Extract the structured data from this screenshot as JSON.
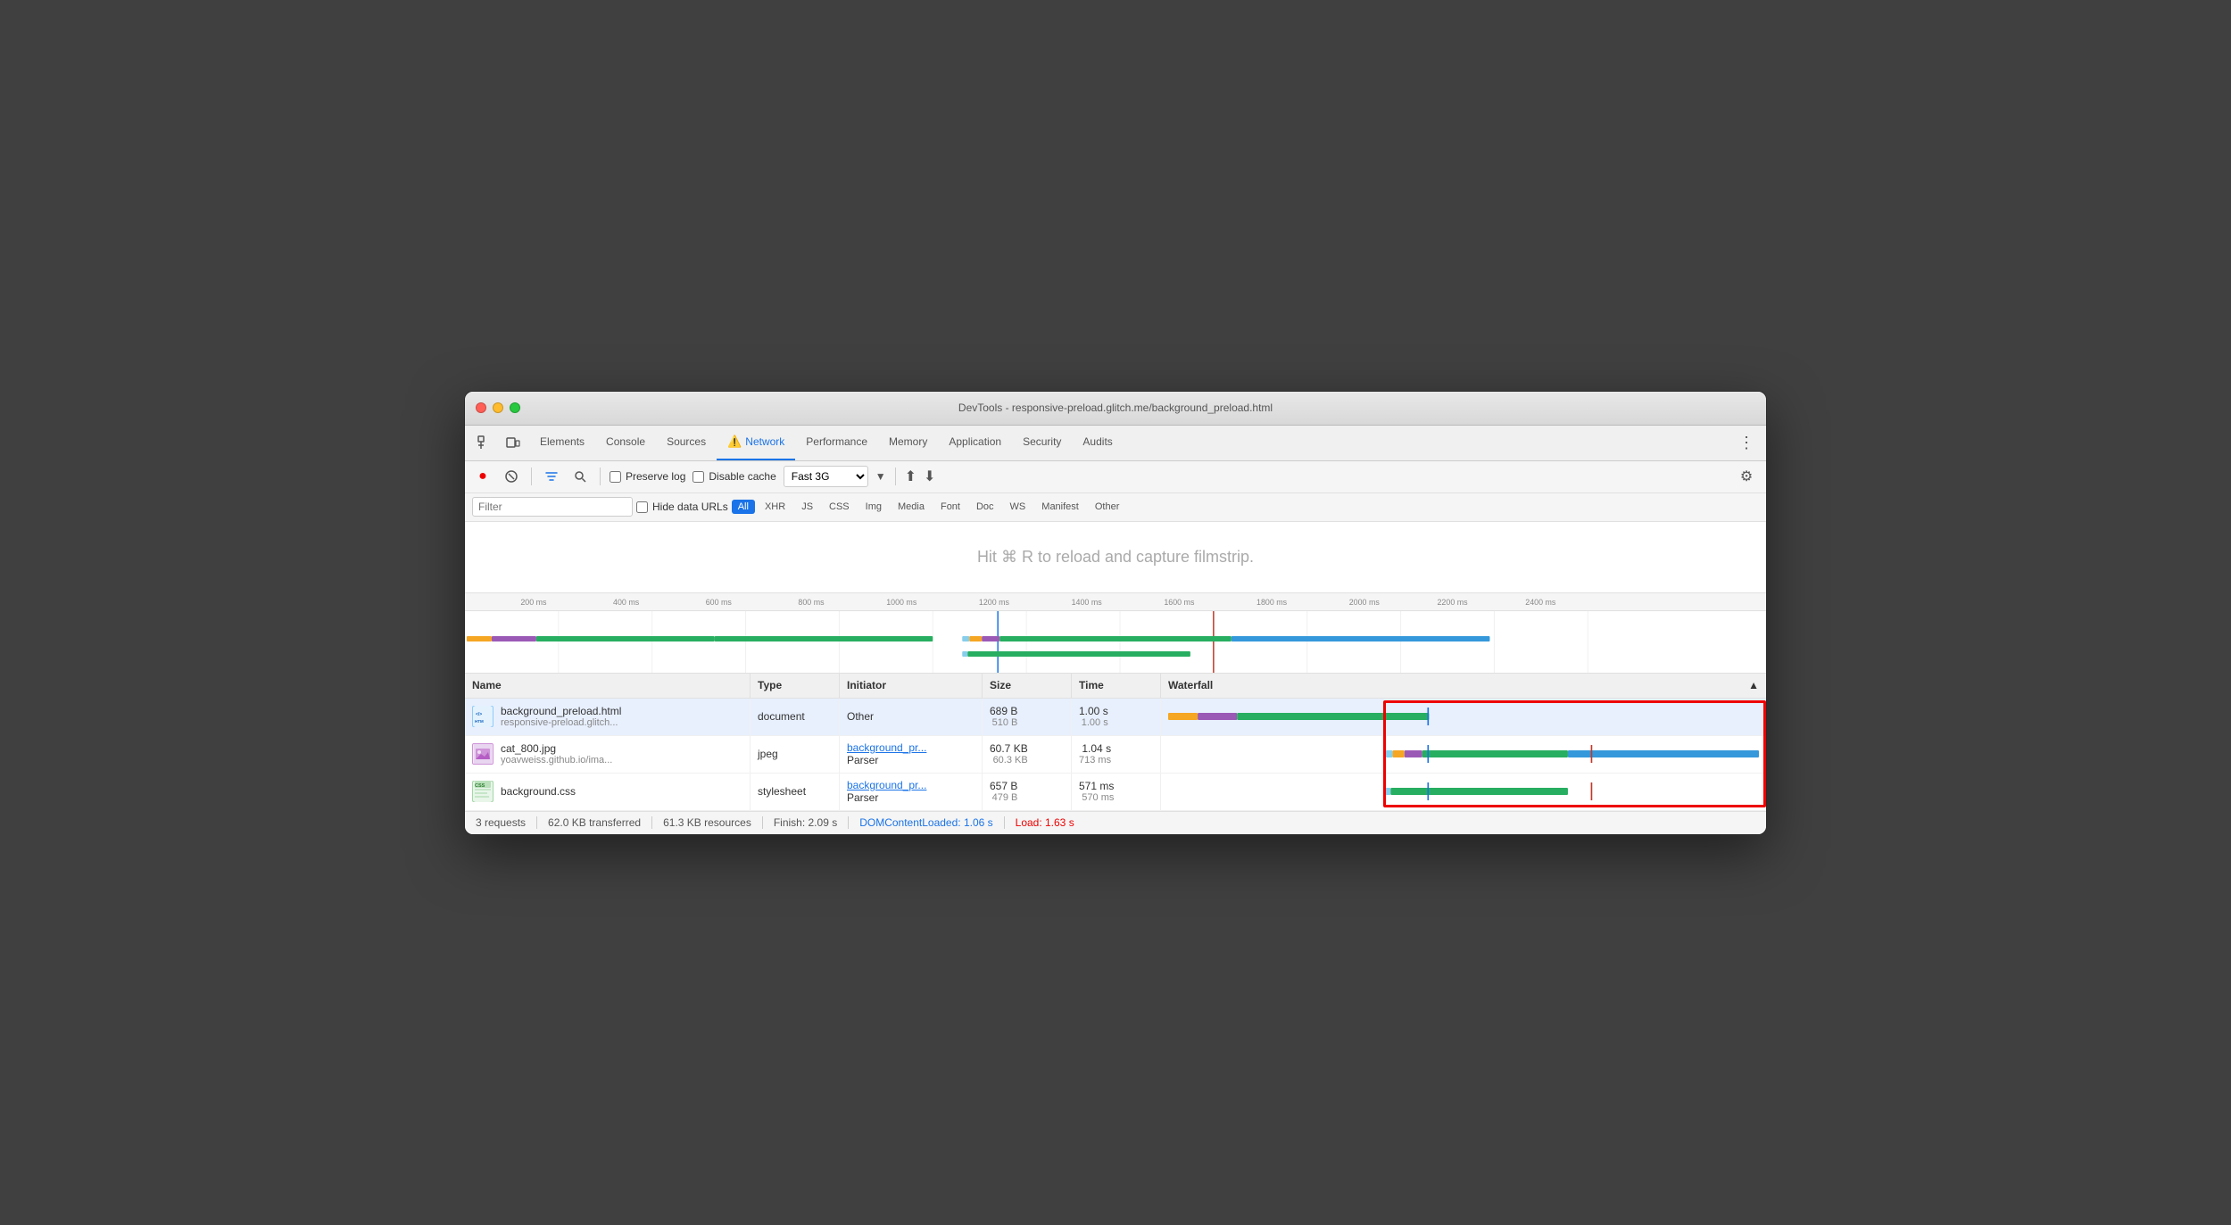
{
  "window": {
    "title": "DevTools - responsive-preload.glitch.me/background_preload.html"
  },
  "tabs": [
    {
      "id": "elements",
      "label": "Elements",
      "active": false
    },
    {
      "id": "console",
      "label": "Console",
      "active": false
    },
    {
      "id": "sources",
      "label": "Sources",
      "active": false
    },
    {
      "id": "network",
      "label": "Network",
      "active": true,
      "icon": "⚠️"
    },
    {
      "id": "performance",
      "label": "Performance",
      "active": false
    },
    {
      "id": "memory",
      "label": "Memory",
      "active": false
    },
    {
      "id": "application",
      "label": "Application",
      "active": false
    },
    {
      "id": "security",
      "label": "Security",
      "active": false
    },
    {
      "id": "audits",
      "label": "Audits",
      "active": false
    }
  ],
  "toolbar": {
    "preserve_log": "Preserve log",
    "disable_cache": "Disable cache",
    "throttle": "Fast 3G"
  },
  "filter": {
    "placeholder": "Filter",
    "hide_data_urls": "Hide data URLs",
    "types": [
      "All",
      "XHR",
      "JS",
      "CSS",
      "Img",
      "Media",
      "Font",
      "Doc",
      "WS",
      "Manifest",
      "Other"
    ]
  },
  "filmstrip": {
    "hint": "Hit ⌘ R to reload and capture filmstrip."
  },
  "ruler": {
    "labels": [
      "200 ms",
      "400 ms",
      "600 ms",
      "800 ms",
      "1000 ms",
      "1200 ms",
      "1400 ms",
      "1600 ms",
      "1800 ms",
      "2000 ms",
      "2200 ms",
      "2400 ms"
    ]
  },
  "table": {
    "columns": [
      "Name",
      "Type",
      "Initiator",
      "Size",
      "Time",
      "Waterfall"
    ],
    "rows": [
      {
        "name": "background_preload.html",
        "url": "responsive-preload.glitch...",
        "type": "document",
        "initiator": "Other",
        "initiator_link": false,
        "size": "689 B",
        "size2": "510 B",
        "time": "1.00 s",
        "time2": "1.00 s",
        "icon_type": "html"
      },
      {
        "name": "cat_800.jpg",
        "url": "yoavweiss.github.io/ima...",
        "type": "jpeg",
        "initiator": "background_pr...",
        "initiator2": "Parser",
        "initiator_link": true,
        "size": "60.7 KB",
        "size2": "60.3 KB",
        "time": "1.04 s",
        "time2": "713 ms",
        "icon_type": "img"
      },
      {
        "name": "background.css",
        "url": "",
        "type": "stylesheet",
        "initiator": "background_pr...",
        "initiator2": "Parser",
        "initiator_link": true,
        "size": "657 B",
        "size2": "479 B",
        "time": "571 ms",
        "time2": "570 ms",
        "icon_type": "css"
      }
    ]
  },
  "status_bar": {
    "requests": "3 requests",
    "transferred": "62.0 KB transferred",
    "resources": "61.3 KB resources",
    "finish": "Finish: 2.09 s",
    "dom_loaded": "DOMContentLoaded: 1.06 s",
    "load": "Load: 1.63 s"
  }
}
